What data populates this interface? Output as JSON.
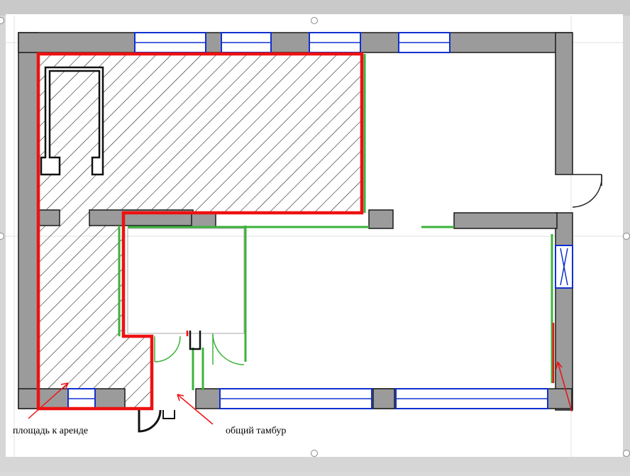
{
  "labels": {
    "rented_area": "площадь к аренде",
    "common_vestibule": "общий тамбур"
  },
  "colors": {
    "wall": "#9b9b9b",
    "wall_outline": "#1a1a1a",
    "window": "#1030d0",
    "rented_outline": "#ee1111",
    "partition": "#3bb33b",
    "hatch": "#111111",
    "background": "#ffffff"
  }
}
